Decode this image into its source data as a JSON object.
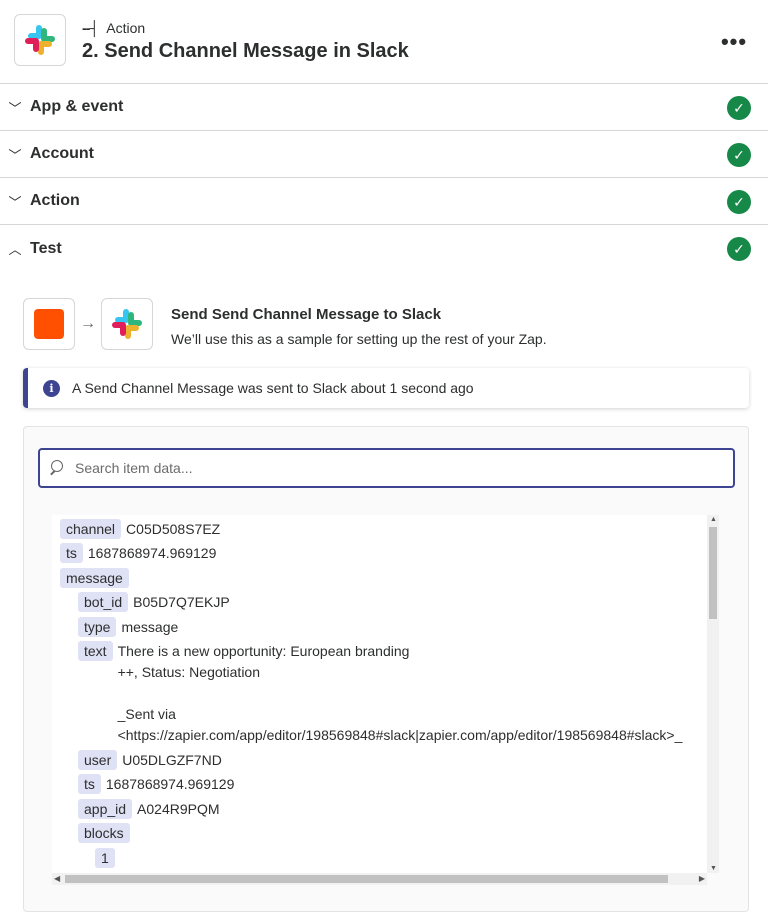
{
  "header": {
    "step_kind": "Action",
    "step_title": "2. Send Channel Message in Slack",
    "more_label": "•••"
  },
  "sections": [
    {
      "label": "App & event",
      "state": "collapsed",
      "complete": true
    },
    {
      "label": "Account",
      "state": "collapsed",
      "complete": true
    },
    {
      "label": "Action",
      "state": "collapsed",
      "complete": true
    },
    {
      "label": "Test",
      "state": "expanded",
      "complete": true
    }
  ],
  "test": {
    "flow_title": "Send Send Channel Message to Slack",
    "flow_subtitle": "We’ll use this as a sample for setting up the rest of your Zap.",
    "alert": "A Send Channel Message was sent to Slack about 1 second ago",
    "search_placeholder": "Search item data..."
  },
  "item_data": [
    {
      "key": "channel",
      "value": "C05D508S7EZ",
      "depth": 0
    },
    {
      "key": "ts",
      "value": "1687868974.969129",
      "depth": 0
    },
    {
      "key": "message",
      "value": "",
      "depth": 0
    },
    {
      "key": "bot_id",
      "value": "B05D7Q7EKJP",
      "depth": 1
    },
    {
      "key": "type",
      "value": "message",
      "depth": 1
    },
    {
      "key": "text",
      "value": "There is a new opportunity: European branding\n++, Status: Negotiation\n\n_Sent via\n<https://zapier.com/app/editor/198569848#slack|zapier.com/app/editor/198569848#slack>_",
      "depth": 1
    },
    {
      "key": "user",
      "value": "U05DLGZF7ND",
      "depth": 1
    },
    {
      "key": "ts",
      "value": "1687868974.969129",
      "depth": 1
    },
    {
      "key": "app_id",
      "value": "A024R9PQM",
      "depth": 1
    },
    {
      "key": "blocks",
      "value": "",
      "depth": 1
    },
    {
      "key": "1",
      "value": "",
      "depth": 2
    }
  ],
  "colors": {
    "accent": "#3d4592",
    "success": "#168847",
    "zapier_orange": "#ff4f00",
    "key_chip": "#dfe1f5"
  },
  "icons": {
    "app": "slack-icon",
    "trigger": "zapier-orange-square",
    "check": "check-circle-icon",
    "info": "info-icon",
    "search": "search-icon"
  }
}
